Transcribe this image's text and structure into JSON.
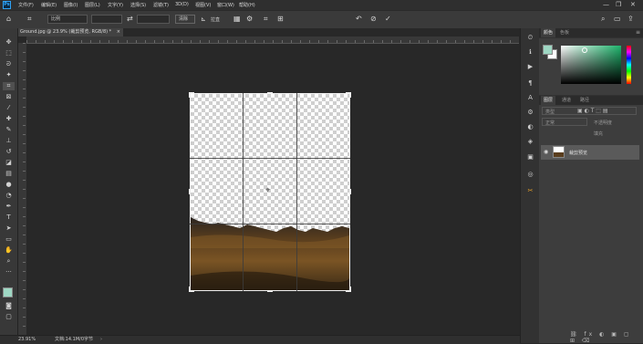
{
  "menu": {
    "logo": "Ps",
    "items": [
      "文件(F)",
      "编辑(E)",
      "图像(I)",
      "图层(L)",
      "文字(Y)",
      "选择(S)",
      "滤镜(T)",
      "3D(D)",
      "视图(V)",
      "窗口(W)",
      "帮助(H)"
    ],
    "window_controls": [
      "—",
      "❐",
      "✕"
    ]
  },
  "options": {
    "ratio_value": "比例",
    "width_value": "",
    "height_value": "",
    "clear_label": "清除",
    "straighten_label": "拉直",
    "reset_icon": "↶",
    "cancel_icon": "⊘",
    "commit_icon": "✓"
  },
  "document": {
    "tab_title": "Ground.jpg @ 23.9% (裁剪预览, RGB/8) *",
    "tab_close": "×"
  },
  "status": {
    "zoom": "23.91%",
    "doc_info": "文档:14.1M/0字节"
  },
  "color_panel": {
    "tabs": [
      "颜色",
      "色板"
    ],
    "foreground": "#9fd8c4",
    "background": "#ffffff",
    "accent": "#1db36b"
  },
  "layers_panel": {
    "tabs": [
      "图层",
      "通道",
      "路径"
    ],
    "kind_label": "类型",
    "blend_mode": "正常",
    "opacity_label": "不透明度",
    "fill_label": "填充",
    "layer_name": "裁剪预览"
  },
  "tools": [
    "move-icon",
    "marquee-icon",
    "lasso-icon",
    "magic-wand-icon",
    "crop-icon",
    "frame-icon",
    "eyedropper-icon",
    "healing-icon",
    "brush-icon",
    "stamp-icon",
    "history-brush-icon",
    "eraser-icon",
    "gradient-icon",
    "blur-icon",
    "dodge-icon",
    "pen-icon",
    "type-icon",
    "path-select-icon",
    "rectangle-icon",
    "hand-icon",
    "zoom-icon",
    "more-icon"
  ]
}
